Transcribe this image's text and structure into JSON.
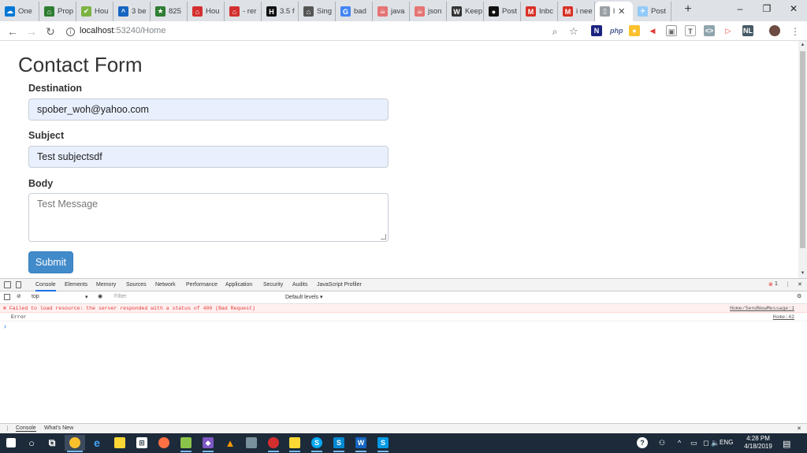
{
  "browser": {
    "tabs": [
      {
        "label": "One",
        "icon": "onedrive-icon",
        "color": "#0078d4",
        "glyph": "☁",
        "width": 50
      },
      {
        "label": "Prop",
        "icon": "property-icon",
        "color": "#2e7d32",
        "glyph": "⌂",
        "width": 47
      },
      {
        "label": "Hou",
        "icon": "check-icon",
        "color": "#7cb342",
        "glyph": "✔",
        "width": 47
      },
      {
        "label": "3 be",
        "icon": "zillow-icon",
        "color": "#1565c0",
        "glyph": "^",
        "width": 47
      },
      {
        "label": "825",
        "icon": "star-icon",
        "color": "#2e7d32",
        "glyph": "★",
        "width": 47
      },
      {
        "label": "Hou",
        "icon": "redfin-icon",
        "color": "#d32f2f",
        "glyph": "⌂",
        "width": 47
      },
      {
        "label": "- rer",
        "icon": "redfin-icon",
        "color": "#d32f2f",
        "glyph": "⌂",
        "width": 47
      },
      {
        "label": "3.5 f",
        "icon": "hp-icon",
        "color": "#111111",
        "glyph": "H",
        "width": 47
      },
      {
        "label": "Sing",
        "icon": "house-icon",
        "color": "#555555",
        "glyph": "⌂",
        "width": 47
      },
      {
        "label": "bad",
        "icon": "google-icon",
        "color": "#4285f4",
        "glyph": "G",
        "width": 47
      },
      {
        "label": "java",
        "icon": "java-icon",
        "color": "#e57373",
        "glyph": "☕",
        "width": 47
      },
      {
        "label": "json",
        "icon": "java-icon",
        "color": "#e57373",
        "glyph": "☕",
        "width": 47
      },
      {
        "label": "Keep",
        "icon": "wikipedia-icon",
        "color": "#333333",
        "glyph": "W",
        "width": 47
      },
      {
        "label": "Post",
        "icon": "github-icon",
        "color": "#111111",
        "glyph": "●",
        "width": 47
      },
      {
        "label": "Inbc",
        "icon": "gmail-icon",
        "color": "#d93025",
        "glyph": "M",
        "width": 47
      },
      {
        "label": "i nee",
        "icon": "gmail-icon",
        "color": "#d93025",
        "glyph": "M",
        "width": 47
      },
      {
        "label": "l",
        "icon": "page-icon",
        "color": "#9aa0a6",
        "glyph": "▯",
        "width": 48,
        "active": true
      },
      {
        "label": "Post",
        "icon": "postman-icon",
        "color": "#90caf9",
        "glyph": "✈",
        "width": 49
      }
    ],
    "new_tab": "+",
    "address": {
      "host": "localhost",
      "path": ":53240/Home"
    },
    "window": {
      "minimize": "–",
      "restore": "❐",
      "close": "✕"
    }
  },
  "page": {
    "title": "Contact Form",
    "form": {
      "destination_label": "Destination",
      "destination_value": "spober_woh@yahoo.com",
      "subject_label": "Subject",
      "subject_value": "Test subjectsdf",
      "body_label": "Body",
      "body_placeholder": "Test Message",
      "submit_label": "Submit"
    }
  },
  "devtools": {
    "tabs": [
      "Console",
      "Elements",
      "Memory",
      "Sources",
      "Network",
      "Performance",
      "Application",
      "Security",
      "Audits",
      "JavaScript Profiler"
    ],
    "selected_tab": "Console",
    "error_count": "1",
    "context": "top",
    "filter_placeholder": "Filter",
    "levels": "Default levels ▾",
    "messages": {
      "error_text": "Failed to load resource: the server responded with a status of 400 (Bad Request)",
      "error_source": "Home/SendNewMessage:1",
      "log_text": "Error",
      "log_source": "Home:42"
    },
    "drawer_tabs": [
      "Console",
      "What's New"
    ]
  },
  "taskbar": {
    "time": "4:28 PM",
    "date": "4/18/2019",
    "lang": "ENG"
  },
  "colors": {
    "accent": "#428bca",
    "autofill": "#e8f0fe",
    "error": "#e53935"
  }
}
